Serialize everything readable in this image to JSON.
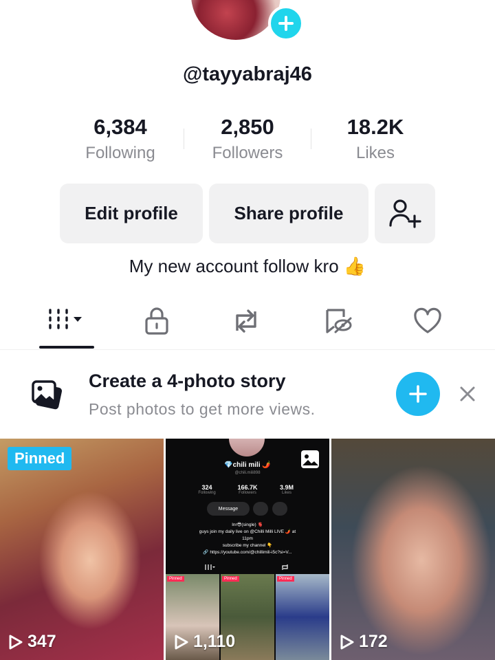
{
  "profile": {
    "username": "@tayyabraj46",
    "bio": "My new account follow kro 👍"
  },
  "stats": [
    {
      "value": "6,384",
      "label": "Following"
    },
    {
      "value": "2,850",
      "label": "Followers"
    },
    {
      "value": "18.2K",
      "label": "Likes"
    }
  ],
  "actions": {
    "edit_label": "Edit profile",
    "share_label": "Share profile"
  },
  "tabs": [
    "videos-grid-icon",
    "lock-icon",
    "repost-icon",
    "tagged-icon",
    "heart-icon"
  ],
  "story_banner": {
    "title": "Create a 4-photo story",
    "subtitle": "Post photos to get more views."
  },
  "videos": [
    {
      "badge": "Pinned",
      "views": "347"
    },
    {
      "views": "1,110"
    },
    {
      "views": "172"
    }
  ],
  "mini_profile": {
    "name": "💎chili mili 🌶️",
    "handle": "@chili.mili898",
    "stats": [
      {
        "value": "324",
        "label": "Following"
      },
      {
        "value": "166.7K",
        "label": "Followers"
      },
      {
        "value": "3.9M",
        "label": "Likes"
      }
    ],
    "message_label": "Message",
    "bio_lines": [
      "lnr😎(single) 🫀",
      "guys join my daily live on @Chilli Milli LIVE 🌶️ at",
      "11pm",
      "subscribe my channel 👇",
      "🔗 https://youtube.com/@chillimili-i5c?si=V..."
    ],
    "pinned_label": "Pinned"
  },
  "colors": {
    "accent": "#20b9f0",
    "avatar_add": "#20d5ec",
    "text": "#161823",
    "muted": "#8a8b91",
    "button_bg": "#f1f1f2"
  }
}
